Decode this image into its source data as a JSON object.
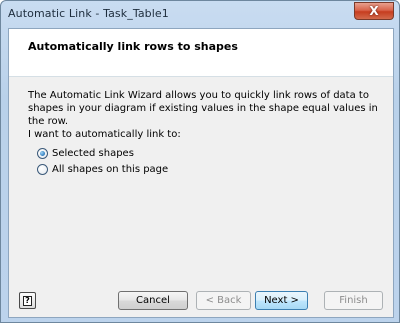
{
  "window": {
    "title": "Automatic Link - Task_Table1",
    "close_glyph": "X"
  },
  "header": {
    "title": "Automatically link rows to shapes"
  },
  "body": {
    "description": "The Automatic Link Wizard allows you to quickly link rows of data to shapes in your diagram if existing values in the shape equal values in the row.",
    "prompt": "I want to automatically link to:",
    "options": [
      {
        "label": "Selected shapes",
        "selected": true
      },
      {
        "label": "All shapes on this page",
        "selected": false
      }
    ]
  },
  "footer": {
    "help_glyph": "?",
    "cancel_label": "Cancel",
    "back_label": "< Back",
    "next_label": "Next >",
    "finish_label": "Finish"
  },
  "colors": {
    "accent": "#3c7fb1",
    "close": "#c63d1f"
  }
}
